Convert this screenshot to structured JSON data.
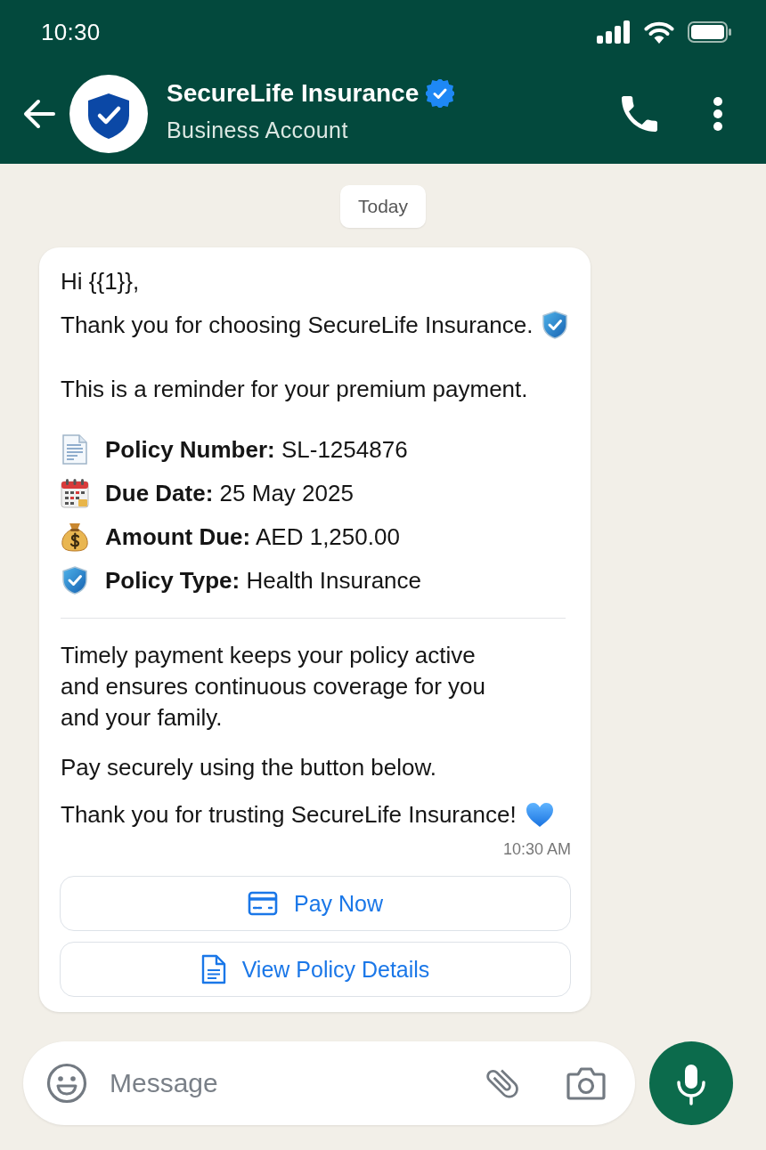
{
  "status_bar": {
    "time": "10:30"
  },
  "header": {
    "title": "SecureLife Insurance",
    "verified": true,
    "subtitle": "Business Account"
  },
  "date_chip": "Today",
  "message": {
    "greeting": "Hi {{1}},",
    "intro": "Thank you for choosing SecureLife Insurance.",
    "reminder": "This is a reminder for your premium payment.",
    "details": [
      "**Policy Number:** SL-1254876",
      "**Due Date:** 25 May 2025",
      "**Amount Due:** AED 1,250.00",
      "**Policy Type:** Health Insurance"
    ],
    "body": "Timely payment keeps your policy active and ensures continuous coverage for you and your family.",
    "cta": "Pay securely using the button below.",
    "closing": "Thank you for trusting SecureLife Insurance!",
    "time": "10:30 AM",
    "buttons": [
      "Pay Now",
      "View Policy Details"
    ]
  },
  "composer": {
    "placeholder": "Message"
  }
}
